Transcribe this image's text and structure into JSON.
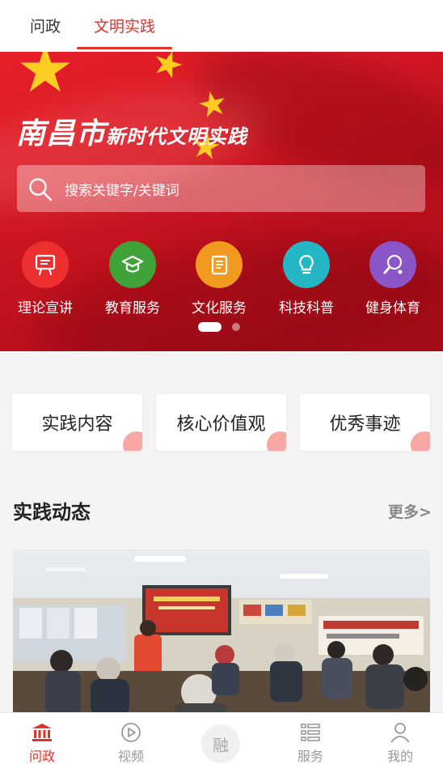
{
  "top_tabs": [
    {
      "label": "问政",
      "active": false
    },
    {
      "label": "文明实践",
      "active": true
    }
  ],
  "banner": {
    "title_big": "南昌市",
    "title_small": "新时代文明实践",
    "search_placeholder": "搜索关键字/关键词",
    "pagination": {
      "current": 1,
      "total": 2
    }
  },
  "categories": [
    {
      "label": "理论宣讲",
      "icon": "lecture-icon",
      "color": "#ee2f2f"
    },
    {
      "label": "教育服务",
      "icon": "graduation-cap-icon",
      "color": "#3fa33a"
    },
    {
      "label": "文化服务",
      "icon": "book-icon",
      "color": "#f29a1f"
    },
    {
      "label": "科技科普",
      "icon": "lightbulb-icon",
      "color": "#25b6c6"
    },
    {
      "label": "健身体育",
      "icon": "ping-pong-icon",
      "color": "#8a55c6"
    }
  ],
  "quick_cards": [
    {
      "label": "实践内容"
    },
    {
      "label": "核心价值观"
    },
    {
      "label": "优秀事迹"
    }
  ],
  "section": {
    "title": "实践动态",
    "more": "更多>"
  },
  "bottom_nav": [
    {
      "label": "问政",
      "icon": "bank-icon",
      "active": true
    },
    {
      "label": "视频",
      "icon": "play-icon",
      "active": false
    },
    {
      "label": "融",
      "icon": "center-icon",
      "active": false
    },
    {
      "label": "服务",
      "icon": "list-icon",
      "active": false
    },
    {
      "label": "我的",
      "icon": "user-icon",
      "active": false
    }
  ],
  "colors": {
    "accent": "#e0322a",
    "banner": "#d11622"
  }
}
